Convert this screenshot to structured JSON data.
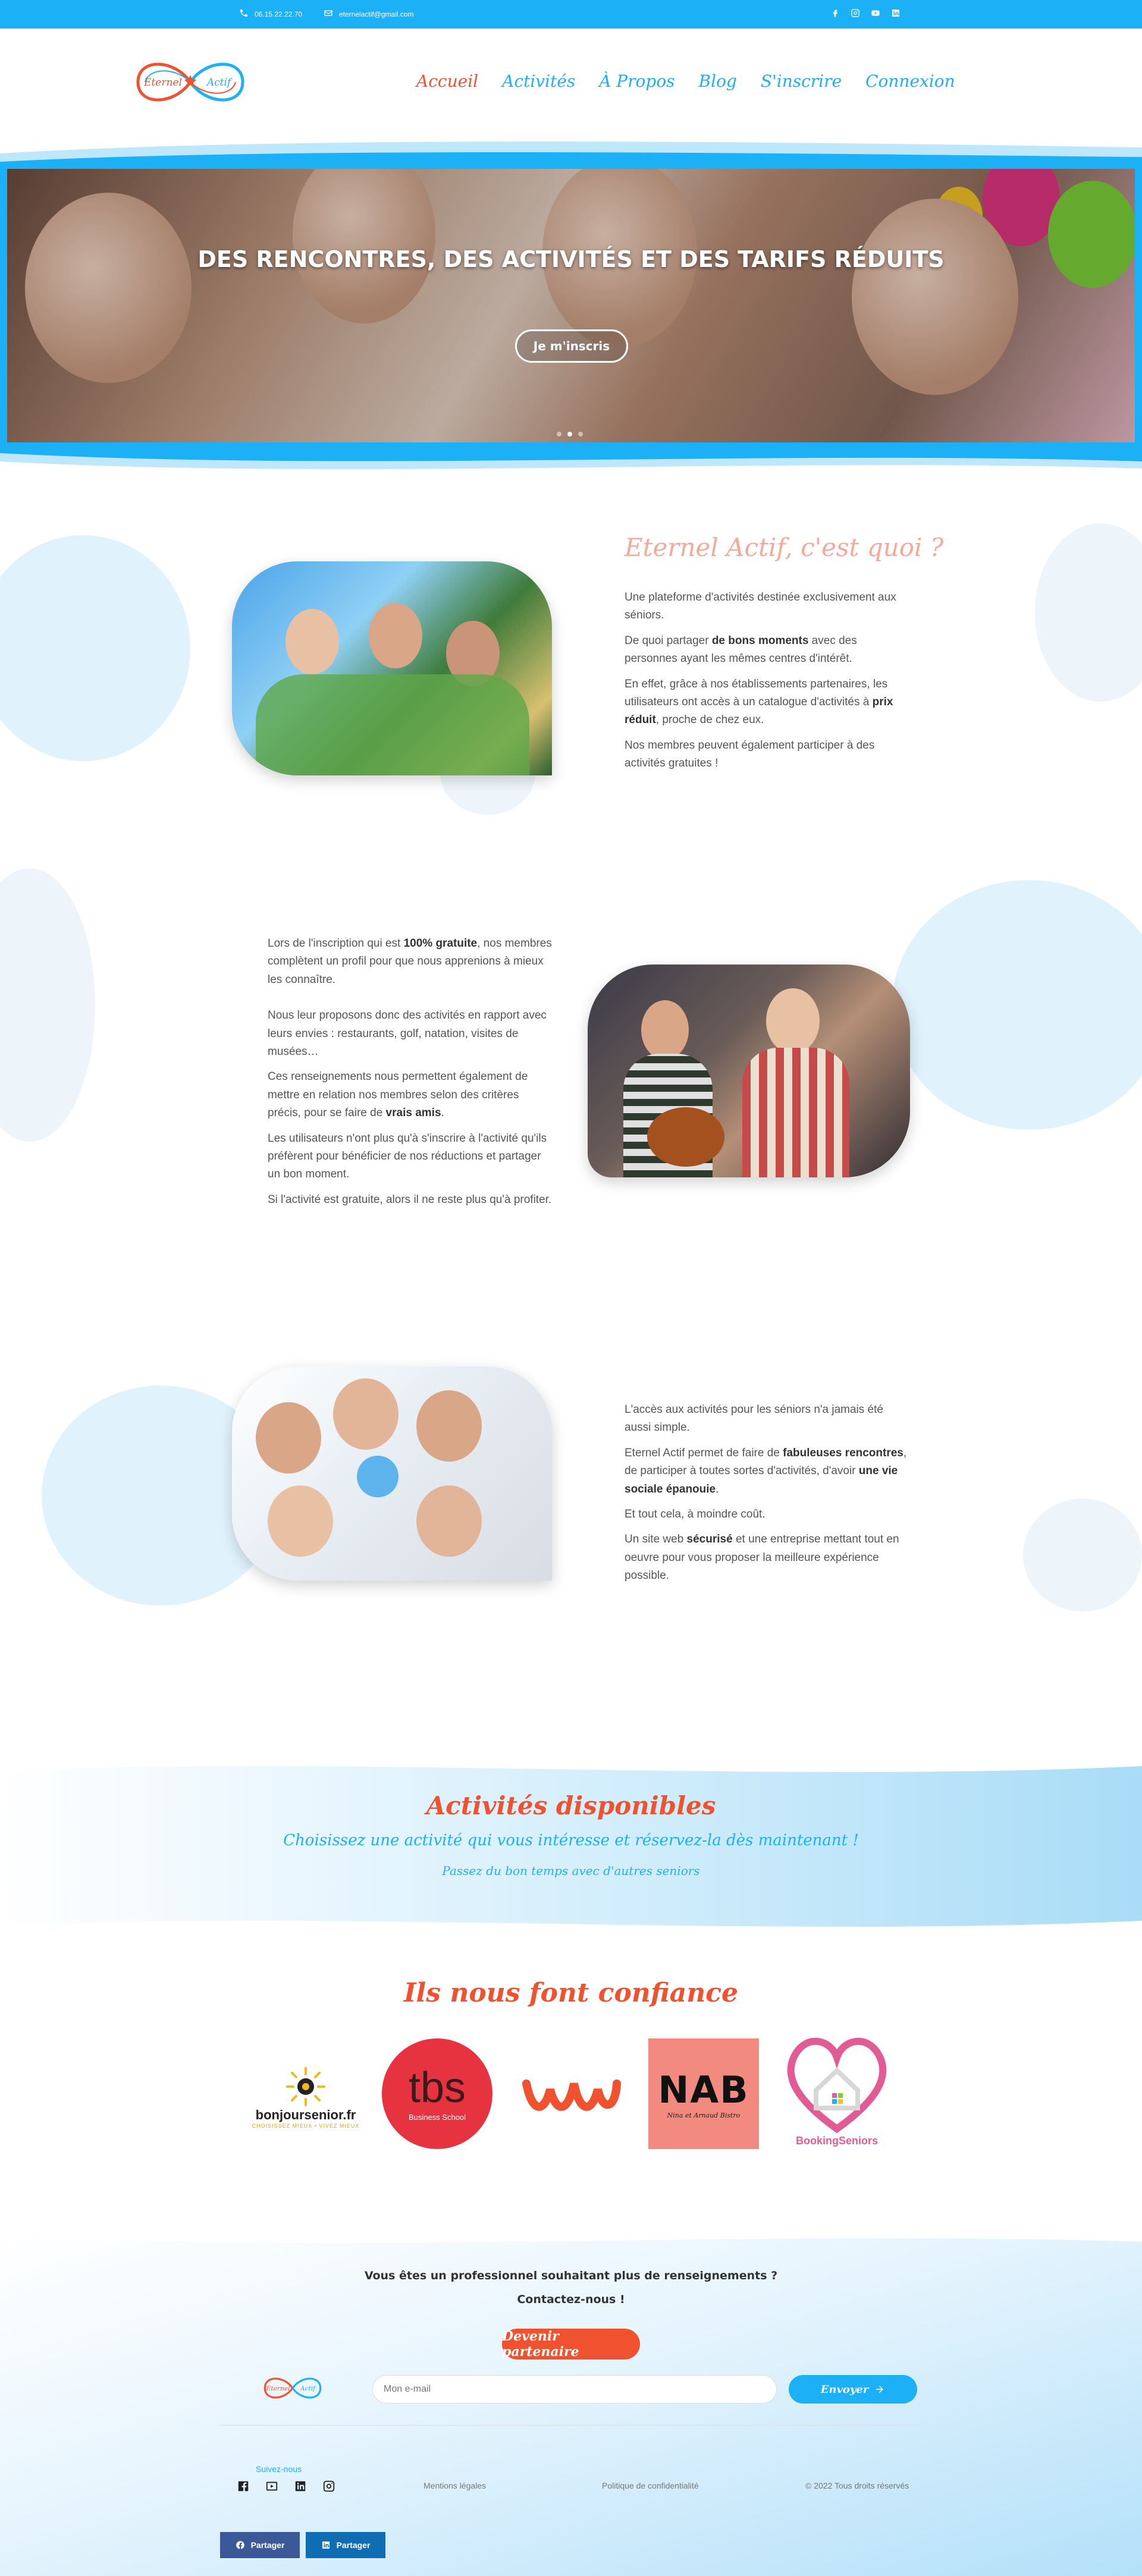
{
  "topbar": {
    "phone": "06.15.22.22.70",
    "email": "eternelactif@gmail.com",
    "social": [
      "facebook-icon",
      "instagram-icon",
      "youtube-icon",
      "linkedin-icon"
    ]
  },
  "nav": {
    "items": [
      {
        "label": "Accueil",
        "active": true
      },
      {
        "label": "Activités",
        "active": false
      },
      {
        "label": "À Propos",
        "active": false
      },
      {
        "label": "Blog",
        "active": false
      },
      {
        "label": "S'inscrire",
        "active": false
      },
      {
        "label": "Connexion",
        "active": false
      }
    ]
  },
  "logo": {
    "left": "Eternel",
    "right": "Actif"
  },
  "hero": {
    "title": "DES RENCONTRES, DES ACTIVITÉS ET DES TARIFS RÉDUITS",
    "button": "Je m'inscris",
    "slides": 3,
    "active_slide": 2
  },
  "section1": {
    "title": "Eternel Actif, c'est quoi ?",
    "p1": "Une plateforme d'activités destinée exclusivement aux séniors.",
    "p2_a": "De quoi partager ",
    "p2_b": "de bons moments",
    "p2_c": " avec des personnes ayant les mêmes centres d'intérêt.",
    "p3_a": "En effet, grâce à nos établissements partenaires, les utilisateurs ont accès à un catalogue d'activités à ",
    "p3_b": "prix réduit",
    "p3_c": ", proche de chez eux.",
    "p4": "Nos membres peuvent également participer à des activités gratuites !"
  },
  "section2": {
    "p1_a": "Lors de l'inscription qui est ",
    "p1_b": "100% gratuite",
    "p1_c": ", nos membres complètent un profil pour que nous apprenions à mieux les connaître.",
    "p2": "Nous leur proposons donc des activités en rapport avec leurs envies : restaurants, golf, natation, visites de musées…",
    "p3_a": "Ces renseignements nous permettent également de mettre en relation nos membres selon des critères précis, pour se faire de ",
    "p3_b": "vrais amis",
    "p3_c": ".",
    "p4": "Les utilisateurs n'ont plus qu'à s'inscrire à l'activité qu'ils préfèrent pour bénéficier de nos réductions et partager un bon moment.",
    "p5": "Si l'activité est gratuite, alors il ne reste plus qu'à profiter."
  },
  "section3": {
    "p1": "L'accès aux activités pour les séniors n'a jamais été aussi simple.",
    "p2_a": "Eternel Actif permet de faire de ",
    "p2_b": "fabuleuses rencontres",
    "p2_c": ", de participer à toutes sortes d'activités, d'avoir ",
    "p2_d": "une vie sociale épanouie",
    "p2_e": ".",
    "p3": "Et tout cela, à moindre coût.",
    "p4_a": "Un site web ",
    "p4_b": "sécurisé",
    "p4_c": " et une entreprise mettant tout en oeuvre pour vous proposer la meilleure expérience possible."
  },
  "activities": {
    "title": "Activités disponibles",
    "subtitle": "Choisissez une activité qui vous intéresse et réservez-la dès maintenant !",
    "subtitle2": "Passez du bon temps avec d'autres seniors"
  },
  "trust": {
    "title": "Ils nous font confiance",
    "partners": [
      {
        "name": "bonjoursenior.fr",
        "tagline": "CHOISISSEZ MIEUX • VIVEZ MIEUX"
      },
      {
        "name": "tbs",
        "tagline": "Business School"
      },
      {
        "name": "ww"
      },
      {
        "name": "NAB",
        "tagline": "Nina et Arnaud Bistro"
      },
      {
        "name": "BookingSeniors"
      }
    ]
  },
  "footer": {
    "line1": "Vous êtes un professionnel souhaitant plus de renseignements ?",
    "line2": "Contactez-nous !",
    "partner_button": "Devenir partenaire",
    "email_placeholder": "Mon e-mail",
    "email_button": "Envoyer",
    "follow": "Suivez-nous",
    "links": [
      "Mentions légales",
      "Politique de confidentialité",
      "© 2022 Tous droits réservés"
    ],
    "share": [
      "Partager",
      "Partager"
    ]
  },
  "colors": {
    "primary": "#1cb0f6",
    "accent": "#f0522f",
    "title_pink": "#f6a99a"
  }
}
